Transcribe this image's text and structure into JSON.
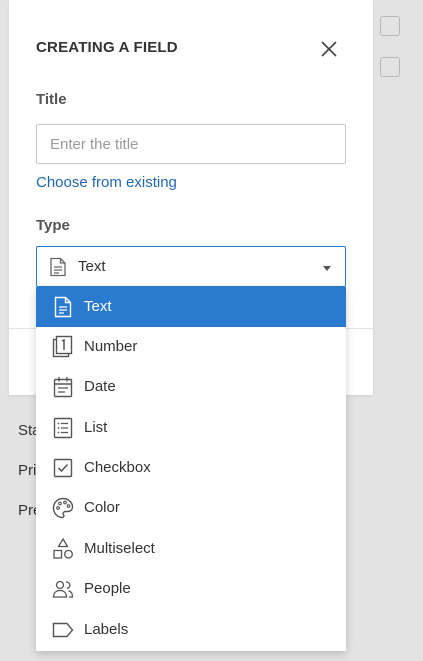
{
  "background": {
    "labels": [
      "Sta",
      "Pri",
      "Pre"
    ]
  },
  "dialog": {
    "title": "CREATING A FIELD",
    "title_label": "Title",
    "title_input": {
      "value": "",
      "placeholder": "Enter the title"
    },
    "choose_existing": "Choose from existing",
    "type_label": "Type",
    "type_select": {
      "value": "Text",
      "icon": "text-doc-icon"
    }
  },
  "dropdown": {
    "selected_index": 0,
    "accent_color": "#2a7bd0",
    "items": [
      {
        "label": "Text",
        "icon": "text-doc-icon"
      },
      {
        "label": "Number",
        "icon": "number-icon"
      },
      {
        "label": "Date",
        "icon": "calendar-icon"
      },
      {
        "label": "List",
        "icon": "list-icon"
      },
      {
        "label": "Checkbox",
        "icon": "checkbox-icon"
      },
      {
        "label": "Color",
        "icon": "palette-icon"
      },
      {
        "label": "Multiselect",
        "icon": "shapes-icon"
      },
      {
        "label": "People",
        "icon": "people-icon"
      },
      {
        "label": "Labels",
        "icon": "tag-icon"
      }
    ]
  }
}
